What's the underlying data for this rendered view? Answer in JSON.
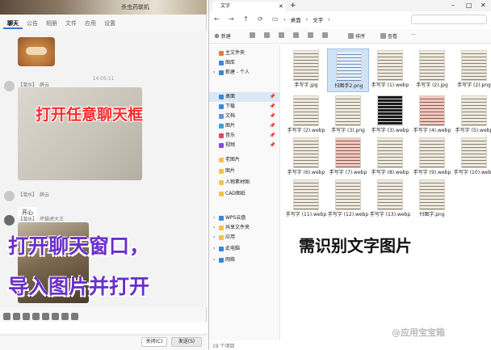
{
  "chat": {
    "banner_title": "杀虫药联机",
    "tabs": [
      "聊天",
      "公告",
      "相册",
      "文件",
      "应用",
      "设置"
    ],
    "timestamp": "14:05:11",
    "messages": [
      {
        "tag": "【潜水】",
        "sender": "薛云"
      },
      {
        "tag": "【潜水】",
        "sender": "薛云",
        "text": "开心"
      },
      {
        "tag": "【潜水】",
        "sender": "坏猫虎大王"
      }
    ],
    "photo_text": "孙如飞",
    "footer": {
      "close": "关闭(C)",
      "send": "发送(S)"
    },
    "toolbar_icons": [
      "smile-icon",
      "cut-icon",
      "folder-icon",
      "image-icon",
      "mic-icon",
      "gift-icon",
      "star-icon",
      "more-icon"
    ]
  },
  "overlays": {
    "caption1": "打开任意聊天框",
    "caption2_line1": "打开聊天窗口，",
    "caption2_line2": "导入图片并打开",
    "caption3": "需识别文字图片"
  },
  "explorer": {
    "tab_title": "文字",
    "breadcrumb": [
      "桌面",
      "文字"
    ],
    "search_placeholder": "",
    "commands": [
      {
        "icon": "new-icon",
        "label": "新建"
      },
      {
        "icon": "cut-icon",
        "label": ""
      },
      {
        "icon": "copy-icon",
        "label": ""
      },
      {
        "icon": "paste-icon",
        "label": ""
      },
      {
        "icon": "rename-icon",
        "label": ""
      },
      {
        "icon": "share-icon",
        "label": ""
      },
      {
        "icon": "delete-icon",
        "label": ""
      },
      {
        "icon": "sort-icon",
        "label": "排序"
      },
      {
        "icon": "view-icon",
        "label": "查看"
      },
      {
        "icon": "more-icon",
        "label": "···"
      }
    ],
    "sidebar": [
      {
        "label": "主文件夹",
        "color": "#e07b39"
      },
      {
        "label": "图库",
        "color": "#3a88d8"
      },
      {
        "label": "新建 - 个人",
        "color": "#3a88d8",
        "chev": "›"
      },
      {
        "label": "桌面",
        "color": "#3a88d8",
        "active": true,
        "pin": true
      },
      {
        "label": "下载",
        "color": "#3a88d8",
        "pin": true
      },
      {
        "label": "文档",
        "color": "#6a8fd8",
        "pin": true
      },
      {
        "label": "图片",
        "color": "#3aa0d8",
        "pin": true
      },
      {
        "label": "音乐",
        "color": "#e0456a",
        "pin": true
      },
      {
        "label": "视频",
        "color": "#8a4ad8",
        "pin": true
      },
      {
        "label": "老图片",
        "color": "#f2c14e"
      },
      {
        "label": "图片",
        "color": "#f2c14e"
      },
      {
        "label": "人物素材图",
        "color": "#f2c14e"
      },
      {
        "label": "CAD图纸",
        "color": "#f2c14e"
      },
      {
        "label": "WPS云盘",
        "color": "#3a88d8",
        "chev": "›"
      },
      {
        "label": "共享文件夹",
        "color": "#f2c14e",
        "chev": "›"
      },
      {
        "label": "应用",
        "color": "#f2c14e",
        "chev": "›"
      },
      {
        "label": "此电脑",
        "color": "#3a88d8",
        "chev": "›"
      },
      {
        "label": "网络",
        "color": "#3a88d8",
        "chev": "›"
      }
    ],
    "files": [
      {
        "name": "手写字.jpg",
        "style": "paper"
      },
      {
        "name": "扫图手2.png",
        "style": "blue",
        "selected": true
      },
      {
        "name": "手写字 (1).webp",
        "style": "paper"
      },
      {
        "name": "手写字 (2).jpg",
        "style": "paper"
      },
      {
        "name": "手写字 (2).png",
        "style": "paper"
      },
      {
        "name": "手写字 (2).webp",
        "style": "paper"
      },
      {
        "name": "手写字 (3).png",
        "style": "paper"
      },
      {
        "name": "手写字 (3).webp",
        "style": "dark"
      },
      {
        "name": "手写字 (4).webp",
        "style": "pink"
      },
      {
        "name": "手写字 (5).webp",
        "style": "paper"
      },
      {
        "name": "手写字 (6).webp",
        "style": "paper"
      },
      {
        "name": "手写字 (7).webp",
        "style": "pink"
      },
      {
        "name": "手写字 (8).webp",
        "style": "paper"
      },
      {
        "name": "手写字 (9).webp",
        "style": "paper"
      },
      {
        "name": "手写字 (10).webp",
        "style": "paper"
      },
      {
        "name": "手写字 (11).webp",
        "style": "paper"
      },
      {
        "name": "手写字 (12).webp",
        "style": "paper"
      },
      {
        "name": "手写字 (13).webp",
        "style": "paper"
      },
      {
        "name": "扫图字.png",
        "style": "paper"
      }
    ],
    "status": "19 个项目"
  },
  "watermark": "@应用宝宝箱"
}
